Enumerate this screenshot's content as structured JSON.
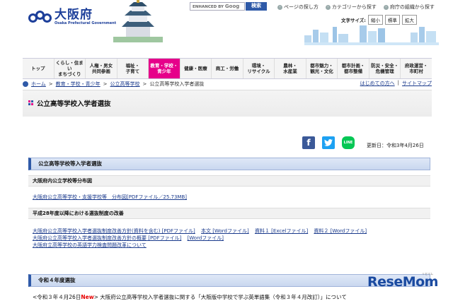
{
  "header": {
    "logo_jp": "大阪府",
    "logo_en": "Osaka Prefectural Government",
    "search_prefix": "ENHANCED BY",
    "search_google": "Goog",
    "search_button": "検索",
    "top_links": [
      "ページの探し方",
      "カテゴリーから探す",
      "府庁の組織から探す"
    ],
    "fontsize_label": "文字サイズ:",
    "fontsize_options": [
      "縮小",
      "標準",
      "拡大"
    ]
  },
  "nav": {
    "items": [
      {
        "label": "トップ",
        "active": false
      },
      {
        "label": "くらし・住まい\nまちづくり",
        "active": false
      },
      {
        "label": "人権・男女\n共同参画",
        "active": false
      },
      {
        "label": "福祉・\n子育て",
        "active": false
      },
      {
        "label": "教育・学校・\n青少年",
        "active": true
      },
      {
        "label": "健康・医療",
        "active": false
      },
      {
        "label": "商工・労働",
        "active": false
      },
      {
        "label": "環境・\nリサイクル",
        "active": false
      },
      {
        "label": "農林・\n水産業",
        "active": false
      },
      {
        "label": "都市魅力・\n観光・文化",
        "active": false
      },
      {
        "label": "都市計画・\n都市整備",
        "active": false
      },
      {
        "label": "防災・安全・\n危機管理",
        "active": false
      },
      {
        "label": "府政運営・\n市町村",
        "active": false
      }
    ]
  },
  "breadcrumb": {
    "items": [
      "ホーム",
      "教育・学校・青少年",
      "公立高等学校",
      "公立高等学校入学者選抜"
    ],
    "right_links": [
      "はじめての方へ",
      "サイトマップ"
    ]
  },
  "page": {
    "title": "公立高等学校入学者選抜",
    "updated": "更新日：令和3年4月26日"
  },
  "social": {
    "line_label": "LINE"
  },
  "sections": {
    "main_heading": "公立高等学校等入学者選抜",
    "sub1": "大阪府内公立学校等分布図",
    "sub1_link": "大阪府公立高等学校・支援学校等　分布図[PDFファイル／25.73MB]",
    "sub2": "平成28年度以降における選抜制度の改善",
    "sub2_row1": [
      "大阪府公立高等学校入学者選抜制度改善方針(資料を含む) [PDFファイル]",
      "本文 [Wordファイル]",
      "資料１ [Excelファイル]",
      "資料２ [Wordファイル]"
    ],
    "sub2_row2": [
      "大阪府公立高等学校入学者選抜制度改善方針の概要 [PDFファイル]",
      "[Wordファイル]"
    ],
    "sub2_row3": "大阪府立高等学校の英語学力検査問題改革について",
    "r4_heading": "令和４年度選抜",
    "notice_pre": "<令和３年４月26日",
    "notice_new": "New",
    "notice_post": "> 大阪府公立高等学校入学者選抜に関する「大阪版中学校で学ぶ英単語集（令和３年４月改訂）」について"
  },
  "watermark": {
    "text": "ReseMom",
    "sub": "リセマム"
  }
}
